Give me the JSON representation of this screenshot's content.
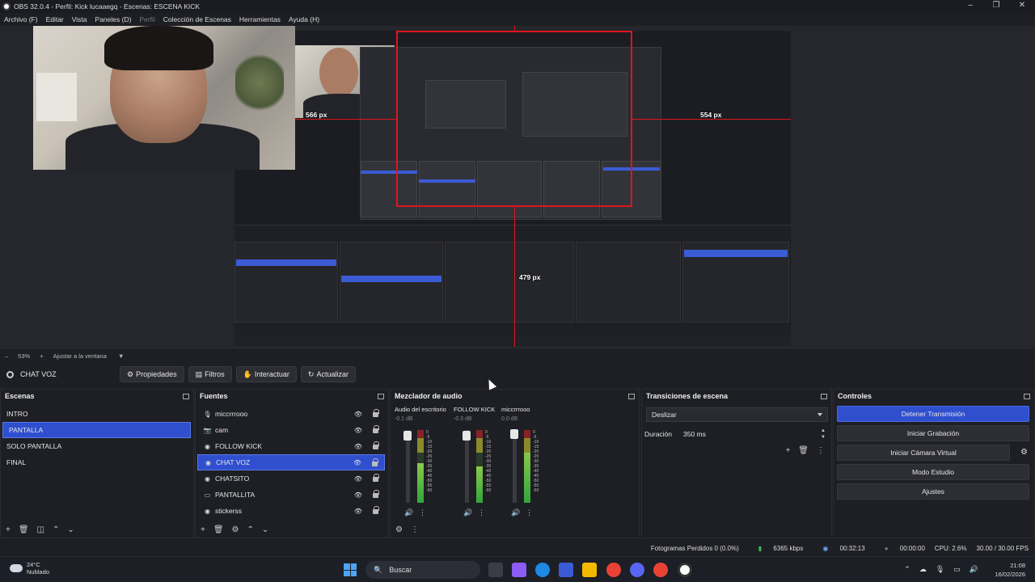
{
  "window": {
    "title": "OBS 32.0.4 - Perfil: Kick lucaaegq - Escenas: ESCENA KICK",
    "controls": [
      "–",
      "❐",
      "✕"
    ]
  },
  "menu": [
    "Archivo (F)",
    "Editar",
    "Vista",
    "Paneles (D)",
    "Perfil",
    "Colección de Escenas",
    "Herramientas",
    "Ayuda (H)"
  ],
  "preview": {
    "label_566": "566 px",
    "label_554": "554 px",
    "label_479": "479 px"
  },
  "zoombar": {
    "minus": "–",
    "zoom": "53%",
    "plus": "+",
    "fit": "Ajustar a la ventana"
  },
  "toolbar": {
    "scene_name": "CHAT VOZ",
    "properties": "Propiedades",
    "filters": "Filtros",
    "interact": "Interactuar",
    "refresh": "Actualizar"
  },
  "scenes": {
    "title": "Escenas",
    "items": [
      "INTRO",
      "PANTALLA",
      "SOLO PANTALLA",
      "FINAL"
    ],
    "active_index": 1
  },
  "sources": {
    "title": "Fuentes",
    "items": [
      {
        "label": "miccrrrooo",
        "icon": "mic-icon"
      },
      {
        "label": "cam",
        "icon": "camera-icon"
      },
      {
        "label": "FOLLOW KICK",
        "icon": "browser-icon"
      },
      {
        "label": "CHAT VOZ",
        "icon": "browser-icon"
      },
      {
        "label": "CHATSITO",
        "icon": "browser-icon"
      },
      {
        "label": "PANTALLITA",
        "icon": "display-icon"
      },
      {
        "label": "stickerss",
        "icon": "browser-icon"
      }
    ],
    "active_index": 3
  },
  "mixer": {
    "title": "Mezclador de audio",
    "channels": [
      {
        "name": "Audio del escritorio",
        "db": "-0.1 dB",
        "level": 0.55
      },
      {
        "name": "FOLLOW KICK",
        "db": "-0.3 dB",
        "level": 0.5
      },
      {
        "name": "miccrrrooo",
        "db": "0.0 dB",
        "level": 0.72
      }
    ],
    "scale": [
      "0",
      "-5",
      "-10",
      "-15",
      "-20",
      "-25",
      "-30",
      "-35",
      "-40",
      "-45",
      "-50",
      "-55",
      "-60"
    ]
  },
  "transitions": {
    "title": "Transiciones de escena",
    "selected": "Deslizar",
    "duration_label": "Duración",
    "duration_value": "350 ms"
  },
  "controls": {
    "title": "Controles",
    "stop_stream": "Detener Transmisión",
    "start_record": "Iniciar Grabación",
    "start_vcam": "Iniciar Cámara Virtual",
    "studio_mode": "Modo Estudio",
    "settings": "Ajustes"
  },
  "status": {
    "dropped_frames": "Fotogramas Perdidos 0 (0.0%)",
    "bitrate": "6365 kbps",
    "live_time": "00:32:13",
    "rec_time": "00:00:00",
    "cpu": "CPU: 2.6%",
    "fps": "30.00 / 30.00 FPS"
  },
  "taskbar": {
    "temp": "24°C",
    "weather": "Nublado",
    "search": "Buscar",
    "time": "21:08",
    "date": "16/02/2026"
  },
  "colors": {
    "accent": "#2f4fcf",
    "guide_red": "#e0141e",
    "meter_green": "#2fa63a"
  }
}
